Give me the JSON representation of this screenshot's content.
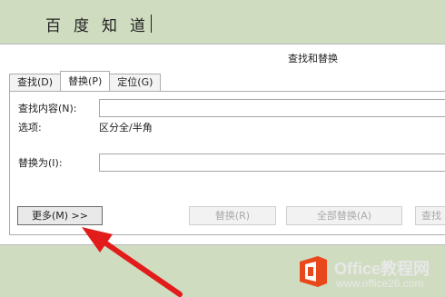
{
  "document": {
    "text": "百度知道"
  },
  "dialog": {
    "title": "查找和替换",
    "tabs": [
      {
        "label": "查找(D)"
      },
      {
        "label": "替换(P)"
      },
      {
        "label": "定位(G)"
      }
    ],
    "find_label": "查找内容(N):",
    "find_value": "",
    "options_label": "选项:",
    "options_value": "区分全/半角",
    "replace_label": "替换为(I):",
    "replace_value": "",
    "more_button": "更多(M) >>",
    "replace_button": "替换(R)",
    "replace_all_button": "全部替换(A)",
    "find_next_button": "查找"
  },
  "watermark": {
    "brand": "Office教程网",
    "url": "www.office26.com",
    "colors": {
      "logo": "#e8481c",
      "arrow": "#e21b1b"
    }
  }
}
